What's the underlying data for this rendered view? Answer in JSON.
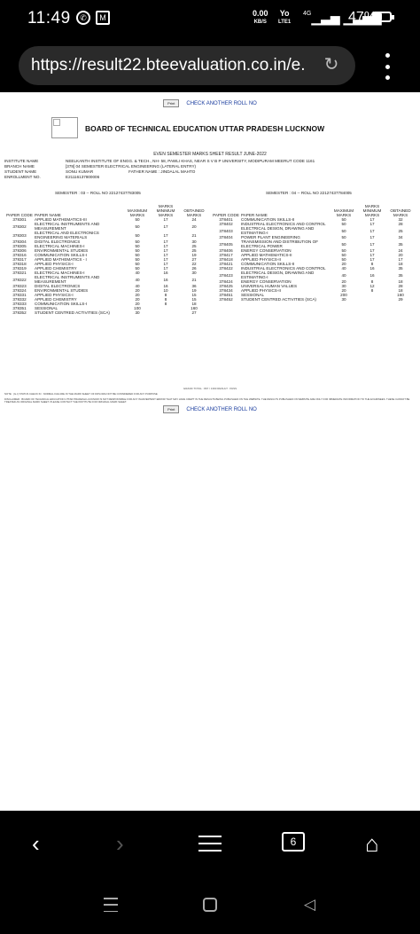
{
  "status": {
    "time": "11:49",
    "net_speed": "0.00",
    "net_unit": "KB/S",
    "volte_top": "Yo",
    "volte_bottom": "LTE1",
    "signal": "4G",
    "battery_percent": "47%",
    "battery_level": 0.47
  },
  "browser": {
    "url": "https://result22.bteevaluation.co.in/e...",
    "tab_count": "6"
  },
  "page": {
    "print_label": "Print",
    "check_another": "CHECK ANOTHER ROLL NO",
    "board_title": "BOARD OF TECHNICAL EDUCATION UTTAR PRADESH LUCKNOW",
    "subtitle": "EVEN SEMESTER MARKS SHEET RESULT JUNE-2022",
    "info": {
      "institute_label": "INSTITUTE NAME",
      "institute_value": "NEELKANTH INSTITUTE OF ENGG. & TECH., NH- 58, PAWLI KHAS, NEAR S V B P UNIVERSITY, MODIPURAM MEERUT  CODE 1161",
      "branch_label": "BRANCH NAME",
      "branch_value": "[378] 04 SEMESTER ELECTRICAL ENGINEERING (LATERAL ENTRY)",
      "student_label": "STUDENT NAME",
      "student_value": "SONU KUMAR",
      "father_value": "FATHER NAME : JINDALAL MAHTO",
      "enroll_label": "ENROLLMENT NO.",
      "enroll_value": "E21116137800006"
    },
    "columns": {
      "code": "PAPER CODE",
      "name": "PAPER NAME",
      "max": "MAXIMUM MARKS",
      "min": "MARKS MINIMUM MARKS",
      "obt": "OBTAINED MARKS"
    },
    "sem3": {
      "head": "SEMESTER : 03 -- ROLL NO 22127437783005",
      "rows": [
        [
          "378301",
          "APPLIED MATHEMATICS-III",
          "50",
          "17",
          "24"
        ],
        [
          "378302",
          "ELECTRICAL INSTRUMENTS AND MEASUREMENT",
          "50",
          "17",
          "20"
        ],
        [
          "378303",
          "ELECTRICAL AND ELECTRONICS ENGINEERING MATERIALS",
          "50",
          "17",
          "21"
        ],
        [
          "378304",
          "DIGITAL ELECTRONICS",
          "50",
          "17",
          "30"
        ],
        [
          "378305",
          "ELECTRICAL MACHINES-I",
          "50",
          "17",
          "25"
        ],
        [
          "378306",
          "ENVIRONMENTAL STUDIES",
          "50",
          "17",
          "25"
        ],
        [
          "378316",
          "COMMUNICATION SKILLS-I",
          "50",
          "17",
          "19"
        ],
        [
          "378317",
          "APPLIED MATHEMATICS - I",
          "50",
          "17",
          "27"
        ],
        [
          "378318",
          "APPLIED PHYSICS-I",
          "50",
          "17",
          "22"
        ],
        [
          "378319",
          "APPLIED CHEMISTRY",
          "50",
          "17",
          "26"
        ],
        [
          "378321",
          "ELECTRICAL MACHINES-I",
          "40",
          "16",
          "30"
        ],
        [
          "378322",
          "ELECTRICAL INSTRUMENTS AND MEASUREMENT",
          "40",
          "16",
          "21"
        ],
        [
          "378323",
          "DIGITAL ELECTRONICS",
          "40",
          "16",
          "36"
        ],
        [
          "378324",
          "ENVIRONMENTAL STUDIES",
          "20",
          "10",
          "19"
        ],
        [
          "378331",
          "APPLIED PHYSICS-I",
          "20",
          "8",
          "15"
        ],
        [
          "378332",
          "APPLIED CHEMISTRY",
          "20",
          "8",
          "15"
        ],
        [
          "378333",
          "COMMUNICATION SKILLS-I",
          "20",
          "8",
          "18"
        ],
        [
          "378351",
          "SESSIONAL",
          "100",
          "",
          "160"
        ],
        [
          "378352",
          "STUDENT CENTRED ACTIVITIES (SCA)",
          "30",
          "",
          "27"
        ]
      ]
    },
    "sem4": {
      "head": "SEMESTER : 04 -- ROLL NO 22127437784005",
      "rows": [
        [
          "378401",
          "COMMUNICATION SKILLS-II",
          "50",
          "17",
          "32"
        ],
        [
          "378402",
          "INDUSTRIAL ELECTRONICS AND CONTROL",
          "50",
          "17",
          "28"
        ],
        [
          "378403",
          "ELECTRICAL DESIGN, DRAWING AND ESTIMATING-I",
          "50",
          "17",
          "25"
        ],
        [
          "378404",
          "POWER PLANT ENGINEERING",
          "50",
          "17",
          "34"
        ],
        [
          "378405",
          "TRANSMISSION AND DISTRIBUTION OF ELECTRICAL POWER",
          "50",
          "17",
          "35"
        ],
        [
          "378406",
          "ENERGY CONSERVATION",
          "50",
          "17",
          "24"
        ],
        [
          "378417",
          "APPLIED MATHEMATICS-II",
          "50",
          "17",
          "20"
        ],
        [
          "378418",
          "APPLIED PHYSICS-II",
          "50",
          "17",
          "17"
        ],
        [
          "378421",
          "COMMUNICATION SKILLS-II",
          "20",
          "8",
          "18"
        ],
        [
          "378422",
          "INDUSTRIAL ELECTRONICS AND CONTROL",
          "40",
          "16",
          "35"
        ],
        [
          "378423",
          "ELECTRICAL DESIGN, DRAWING AND ESTIMATING-I",
          "40",
          "16",
          "35"
        ],
        [
          "378424",
          "ENERGY CONSERVATION",
          "20",
          "8",
          "18"
        ],
        [
          "378425",
          "UNIVERSAL HUMAN VALUES",
          "30",
          "12",
          "28"
        ],
        [
          "378434",
          "APPLIED PHYSICS-II",
          "20",
          "8",
          "18"
        ],
        [
          "378451",
          "SESSIONAL",
          "200",
          "",
          "160"
        ],
        [
          "378452",
          "STUDENT CENTRED ACTIVITIES (SCA)",
          "30",
          "",
          "29"
        ]
      ]
    },
    "grand_total": "GRAND TOTAL : 897 / 1390 RESULT : PASS",
    "note": "NOTE : (G-I) STATUS CHECK IN : NORMAL FAILURE IN THE MARK SHEET OF DIPLOMA NOT BE CONSIDERED FOR ANY PURPOSE",
    "disclaimer": "DISCLAIMER : BOARD OF TECHNICAL EDUCATION UTTAR PRADESH LUCKNOW IS NOT RESPONSIBLE FOR ANY INADVERTENT ERROR THAT MAY HAVE CREPT IN THE RESULTS BEING PUBLISHED ON THE WEBSITE. THE RESULTS PUBLISHED ON WEBSITE ARE ONLY FOR IMMEDIATE INFORMATION TO THE EXAMINEES. THESE CANNOT BE TREATED AS ORIGINAL MARK SHEET. PLEASE CONTACT THE INSTITUTE FOR ORIGINAL MARK SHEET."
  }
}
